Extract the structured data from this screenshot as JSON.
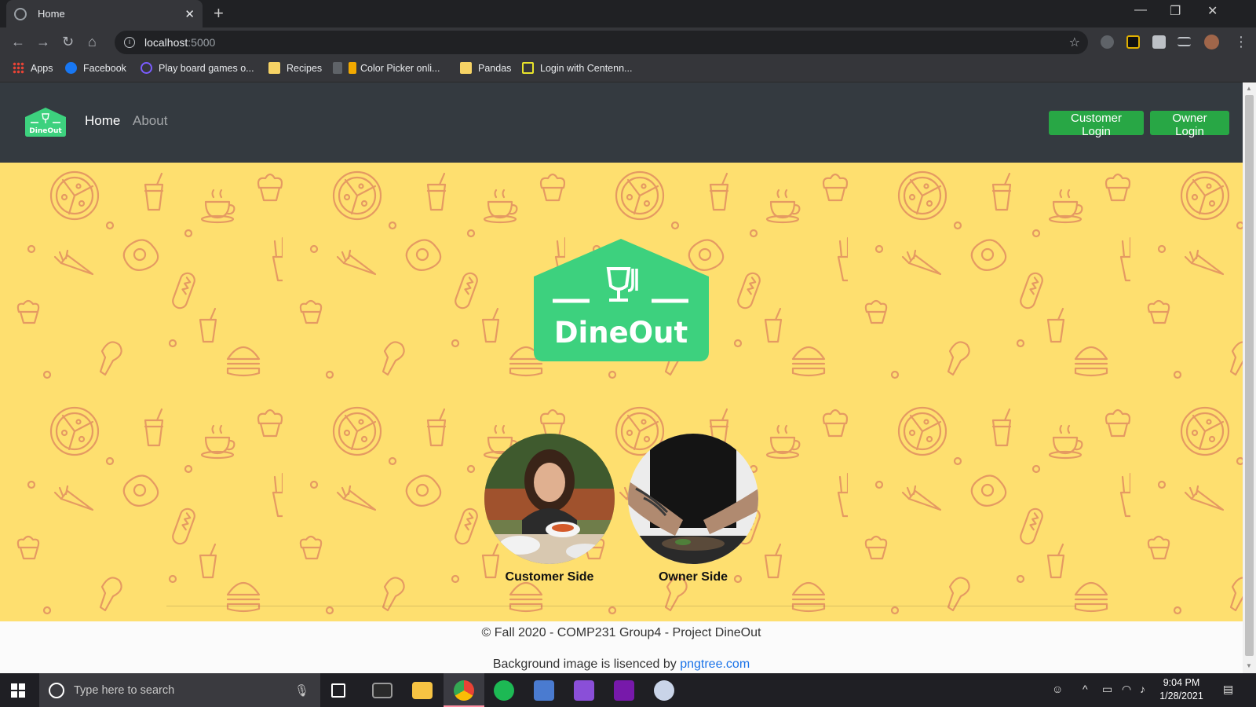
{
  "browser": {
    "tab_title": "Home",
    "new_tab": "+",
    "url_host": "localhost",
    "url_port": ":5000",
    "window_controls": [
      "—",
      "❐",
      "✕"
    ],
    "bookmarks": [
      {
        "label": "Apps",
        "icon": "apps-grid-icon",
        "color": "#ea4335"
      },
      {
        "label": "Facebook",
        "icon": "facebook-icon",
        "color": "#1877f2"
      },
      {
        "label": "Play board games o...",
        "icon": "board-games-icon",
        "color": "#7a5cff"
      },
      {
        "label": "Recipes",
        "icon": "folder-icon",
        "color": "#f6d365"
      },
      {
        "label": "Color Picker onli...",
        "icon": "color-picker-icon",
        "color": "#f2a900"
      },
      {
        "label": "Pandas",
        "icon": "folder-icon",
        "color": "#f6d365"
      },
      {
        "label": "Login with Centenn...",
        "icon": "centennial-icon",
        "color": "#e8e32b"
      }
    ]
  },
  "site": {
    "brand": "DineOut",
    "nav": {
      "home": "Home",
      "about": "About"
    },
    "buttons": {
      "customer_login": "Customer Login",
      "owner_login": "Owner Login"
    },
    "accent": "#28a745",
    "logo_color": "#3dd17e",
    "hero_bg": "#fedf6f",
    "roles": [
      {
        "label": "Customer Side",
        "image": "woman-dining-photo"
      },
      {
        "label": "Owner Side",
        "image": "chef-plating-photo"
      }
    ],
    "footer": {
      "copyright": "© Fall 2020 - COMP231 Group4 - Project DineOut",
      "credit_prefix": "Background image is lisenced by ",
      "credit_link": "pngtree.com"
    }
  },
  "taskbar": {
    "search_placeholder": "Type here to search",
    "time": "9:04 PM",
    "date": "1/28/2021"
  }
}
